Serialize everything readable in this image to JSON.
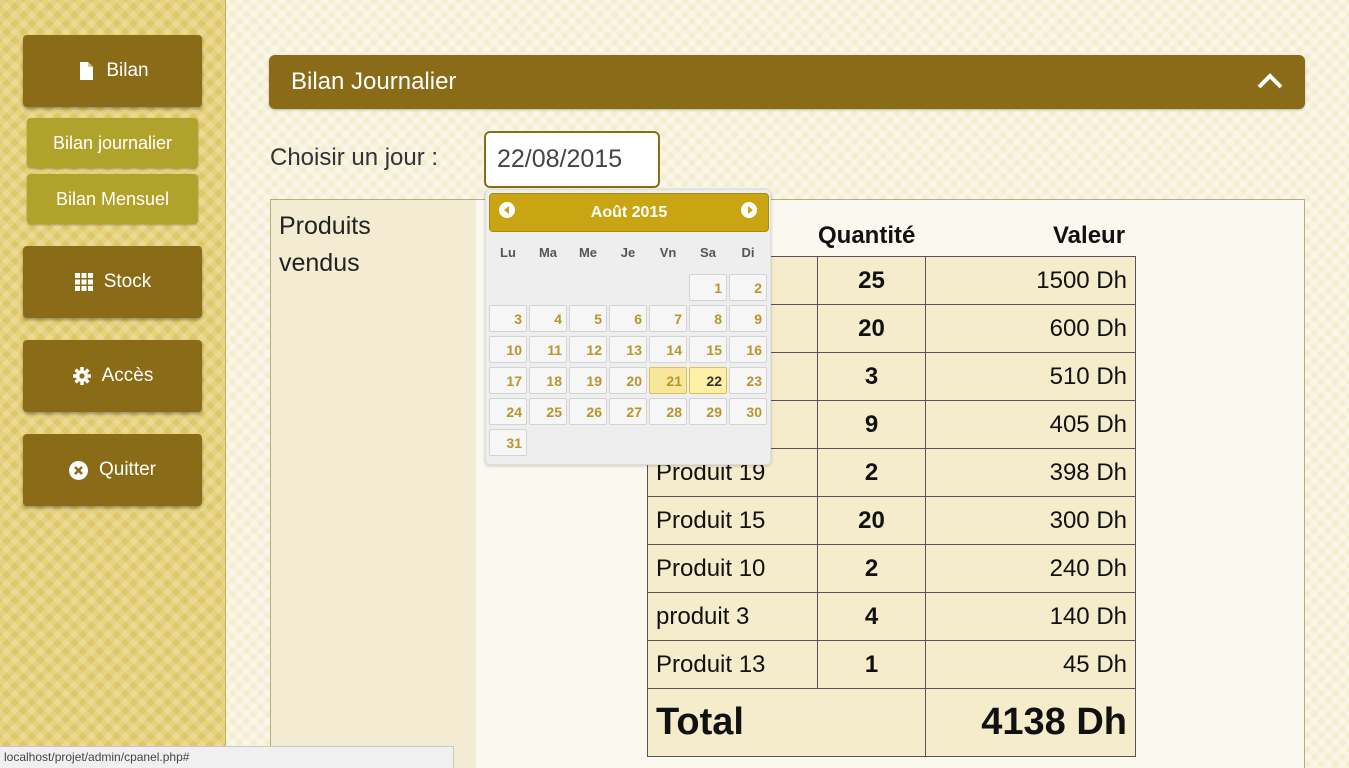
{
  "sidebar": {
    "bilan": "Bilan",
    "bilan_journalier": "Bilan journalier",
    "bilan_mensuel": "Bilan Mensuel",
    "stock": "Stock",
    "acces": "Accès",
    "quitter": "Quitter"
  },
  "panel": {
    "title": "Bilan Journalier",
    "choose_label": "Choisir un jour :",
    "date_value": "22/08/2015"
  },
  "products_title_line1": "Produits",
  "products_title_line2": "vendus",
  "table": {
    "headers": {
      "qty": "Quantité",
      "value": "Valeur"
    },
    "rows": [
      {
        "name": "",
        "qty": "25",
        "value": "1500 Dh"
      },
      {
        "name": "",
        "qty": "20",
        "value": "600 Dh"
      },
      {
        "name": "",
        "qty": "3",
        "value": "510 Dh"
      },
      {
        "name": "",
        "qty": "9",
        "value": "405 Dh"
      },
      {
        "name": "Produit 19",
        "qty": "2",
        "value": "398 Dh"
      },
      {
        "name": "Produit 15",
        "qty": "20",
        "value": "300 Dh"
      },
      {
        "name": "Produit 10",
        "qty": "2",
        "value": "240 Dh"
      },
      {
        "name": "produit 3",
        "qty": "4",
        "value": "140 Dh"
      },
      {
        "name": "Produit 13",
        "qty": "1",
        "value": "45 Dh"
      }
    ],
    "total_label": "Total",
    "total_value": "4138 Dh"
  },
  "datepicker": {
    "month_label": "Août 2015",
    "weekdays": [
      "Lu",
      "Ma",
      "Me",
      "Je",
      "Vn",
      "Sa",
      "Di"
    ],
    "first_weekday_index": 5,
    "days": 31,
    "highlighted_day": 21,
    "selected_day": 22
  },
  "statusbar": {
    "url": "localhost/projet/admin/cpanel.php#"
  }
}
